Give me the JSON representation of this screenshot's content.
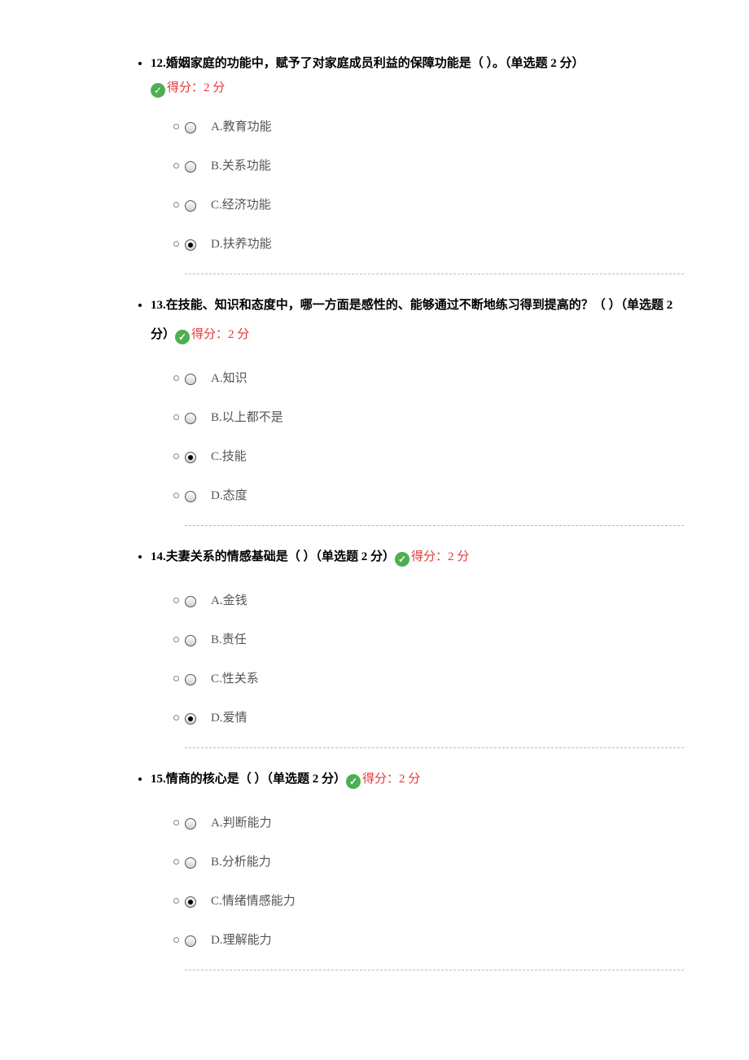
{
  "score_label": "得分：2 分",
  "type_label": "（单选题 2 分）",
  "questions": [
    {
      "num": "12.",
      "text": "婚姻家庭的功能中，赋予了对家庭成员利益的保障功能是（ ）。",
      "score_inline": false,
      "options": [
        {
          "label": "A.教育功能",
          "selected": false
        },
        {
          "label": "B.关系功能",
          "selected": false
        },
        {
          "label": "C.经济功能",
          "selected": false
        },
        {
          "label": "D.扶养功能",
          "selected": true
        }
      ]
    },
    {
      "num": "13.",
      "text": "在技能、知识和态度中，哪一方面是感性的、能够通过不断地练习得到提高的？（ ）",
      "score_inline": true,
      "options": [
        {
          "label": "A.知识",
          "selected": false
        },
        {
          "label": "B.以上都不是",
          "selected": false
        },
        {
          "label": "C.技能",
          "selected": true
        },
        {
          "label": "D.态度",
          "selected": false
        }
      ]
    },
    {
      "num": "14.",
      "text": "夫妻关系的情感基础是（ ）",
      "score_inline": true,
      "options": [
        {
          "label": "A.金钱",
          "selected": false
        },
        {
          "label": "B.责任",
          "selected": false
        },
        {
          "label": "C.性关系",
          "selected": false
        },
        {
          "label": "D.爱情",
          "selected": true
        }
      ]
    },
    {
      "num": "15.",
      "text": "情商的核心是（ ）",
      "score_inline": true,
      "options": [
        {
          "label": "A.判断能力",
          "selected": false
        },
        {
          "label": "B.分析能力",
          "selected": false
        },
        {
          "label": "C.情绪情感能力",
          "selected": true
        },
        {
          "label": "D.理解能力",
          "selected": false
        }
      ]
    }
  ]
}
